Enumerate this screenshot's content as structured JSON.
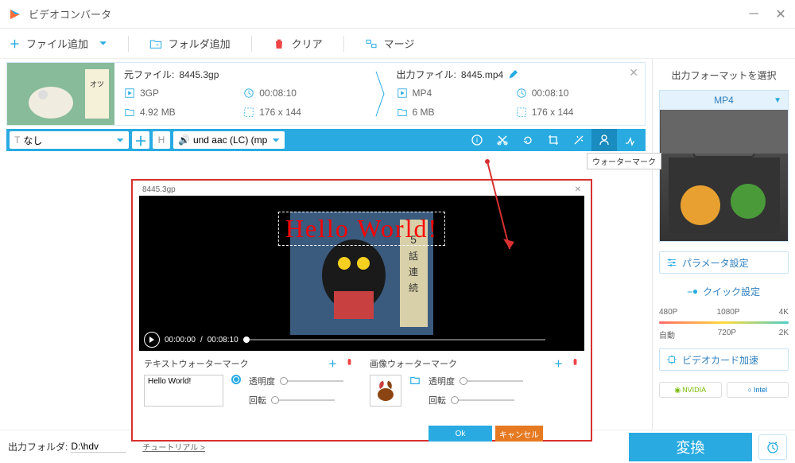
{
  "app": {
    "title": "ビデオコンバータ"
  },
  "toolbar": {
    "add_file": "ファイル追加",
    "add_folder": "フォルダ追加",
    "clear": "クリア",
    "merge": "マージ"
  },
  "file": {
    "source_label": "元ファイル:",
    "source_name": "8445.3gp",
    "output_label": "出力ファイル:",
    "output_name": "8445.mp4",
    "src": {
      "format": "3GP",
      "duration": "00:08:10",
      "size": "4.92 MB",
      "res": "176 x 144"
    },
    "out": {
      "format": "MP4",
      "duration": "00:08:10",
      "size": "6 MB",
      "res": "176 x 144"
    }
  },
  "actionbar": {
    "subtitle_none": "なし",
    "audio_track": "und aac (LC) (mp",
    "tooltip_watermark": "ウォーターマーク"
  },
  "watermark": {
    "filename": "8445.3gp",
    "overlay_text": "Hello World!",
    "time_current": "00:00:00",
    "time_total": "00:08:10",
    "text_section_title": "テキストウォーターマーク",
    "image_section_title": "画像ウォーターマーク",
    "text_value": "Hello World!",
    "opacity_label": "透明度",
    "rotation_label": "回転",
    "ok": "Ok",
    "cancel": "キャンセル"
  },
  "sidebar": {
    "title": "出力フォーマットを選択",
    "format": "MP4",
    "params": "パラメータ設定",
    "quick": "クイック設定",
    "q": [
      "480P",
      "1080P",
      "4K"
    ],
    "q2": [
      "自動",
      "720P",
      "2K"
    ],
    "hw_accel": "ビデオカード加速",
    "nvidia": "NVIDIA",
    "intel": "Intel"
  },
  "bottom": {
    "folder_label": "出力フォルダ:",
    "folder_value": "D:\\hdv",
    "tutorial": "チュートリアル >",
    "convert": "変換"
  }
}
